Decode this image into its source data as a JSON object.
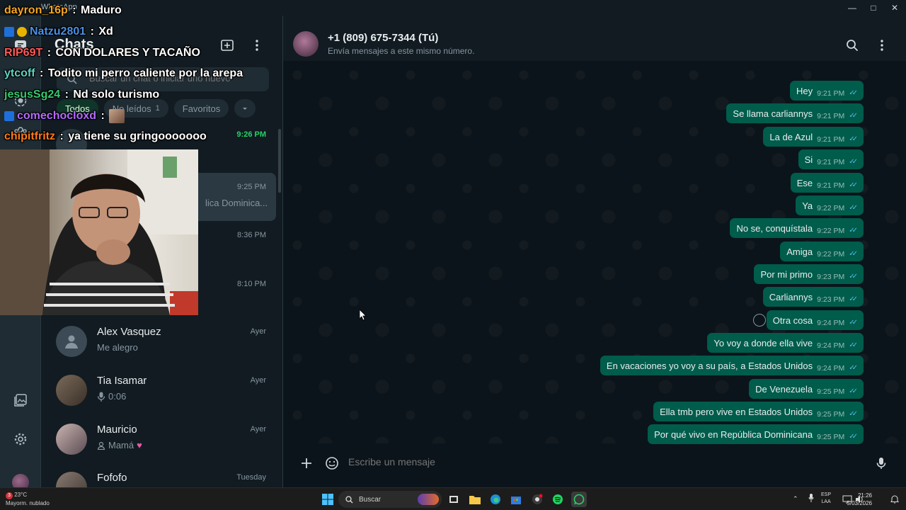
{
  "window": {
    "title": "WhatsApp"
  },
  "sidebar_title": "Chats",
  "search": {
    "placeholder": "Buscar un chat o iniciar uno nuevo"
  },
  "filters": [
    {
      "label": "Todos",
      "count": ""
    },
    {
      "label": "No leídos",
      "count": "1"
    },
    {
      "label": "Favoritos",
      "count": ""
    }
  ],
  "chats": [
    {
      "name": "",
      "preview": "",
      "time": "9:26 PM"
    },
    {
      "name": "",
      "preview": "lica Dominica...",
      "time": "9:25 PM"
    },
    {
      "name": "",
      "preview": "",
      "time": "8:36 PM"
    },
    {
      "name": "",
      "preview": "",
      "time": "8:10 PM"
    },
    {
      "name": "Alex Vasquez",
      "preview": "Me alegro",
      "time": "Ayer"
    },
    {
      "name": "Tia Isamar",
      "preview": "0:06",
      "time": "Ayer"
    },
    {
      "name": "Mauricio",
      "preview": "Mamá",
      "time": "Ayer"
    },
    {
      "name": "Fofofo",
      "preview": "",
      "time": "Tuesday"
    }
  ],
  "conversation": {
    "name": "+1 (809) 675-7344 (Tú)",
    "subtitle": "Envía mensajes a este mismo número.",
    "messages": [
      {
        "text": "Hey",
        "time": "9:21 PM"
      },
      {
        "text": "Se llama carliannys",
        "time": "9:21 PM"
      },
      {
        "text": "La de Azul",
        "time": "9:21 PM"
      },
      {
        "text": "Si",
        "time": "9:21 PM"
      },
      {
        "text": "Ese",
        "time": "9:21 PM"
      },
      {
        "text": "Ya",
        "time": "9:22 PM"
      },
      {
        "text": "No se, conquístala",
        "time": "9:22 PM"
      },
      {
        "text": "Amiga",
        "time": "9:22 PM"
      },
      {
        "text": "Por mi primo",
        "time": "9:23 PM"
      },
      {
        "text": "Carliannys",
        "time": "9:23 PM"
      },
      {
        "text": "Otra cosa",
        "time": "9:24 PM"
      },
      {
        "text": "Yo voy a donde ella vive",
        "time": "9:24 PM"
      },
      {
        "text": "En vacaciones yo voy a su país, a Estados Unidos",
        "time": "9:24 PM"
      },
      {
        "text": "De Venezuela",
        "time": "9:25 PM"
      },
      {
        "text": "Ella tmb pero vive en Estados Unidos",
        "time": "9:25 PM"
      },
      {
        "text": "Por qué vivo en República Dominicana",
        "time": "9:25 PM"
      }
    ],
    "composer_placeholder": "Escribe un mensaje"
  },
  "stream_chat": [
    {
      "user": "dayron_16p",
      "text": "Maduro",
      "color": "#f5a623"
    },
    {
      "user": "Natzu2801",
      "text": "Xd",
      "color": "#4a90e2"
    },
    {
      "user": "RIP69T",
      "text": "CON DOLARES Y TACAÑO",
      "color": "#ff5a5a"
    },
    {
      "user": "ytcoff",
      "text": "Todito mi perro caliente por la arepa",
      "color": "#5fd3c4"
    },
    {
      "user": "jesusSg24",
      "text": "Nd solo turismo",
      "color": "#37c871"
    },
    {
      "user": "comechocloxd",
      "text": "",
      "color": "#b36bff"
    },
    {
      "user": "chipitfritz",
      "text": "ya tiene su gringooooooo",
      "color": "#ff7a1a"
    }
  ],
  "taskbar": {
    "weather_temp": "23°C",
    "weather_desc": "Mayorm. nublado",
    "weather_badge": "3",
    "search_label": "Buscar",
    "lang_1": "ESP",
    "lang_2": "LAA",
    "time": "21:26",
    "date": "5/03/2026"
  },
  "colors": {
    "accent": "#00a884",
    "bubble_out": "#005c4b",
    "panel": "#111b21",
    "read_ticks": "#53bdeb"
  }
}
